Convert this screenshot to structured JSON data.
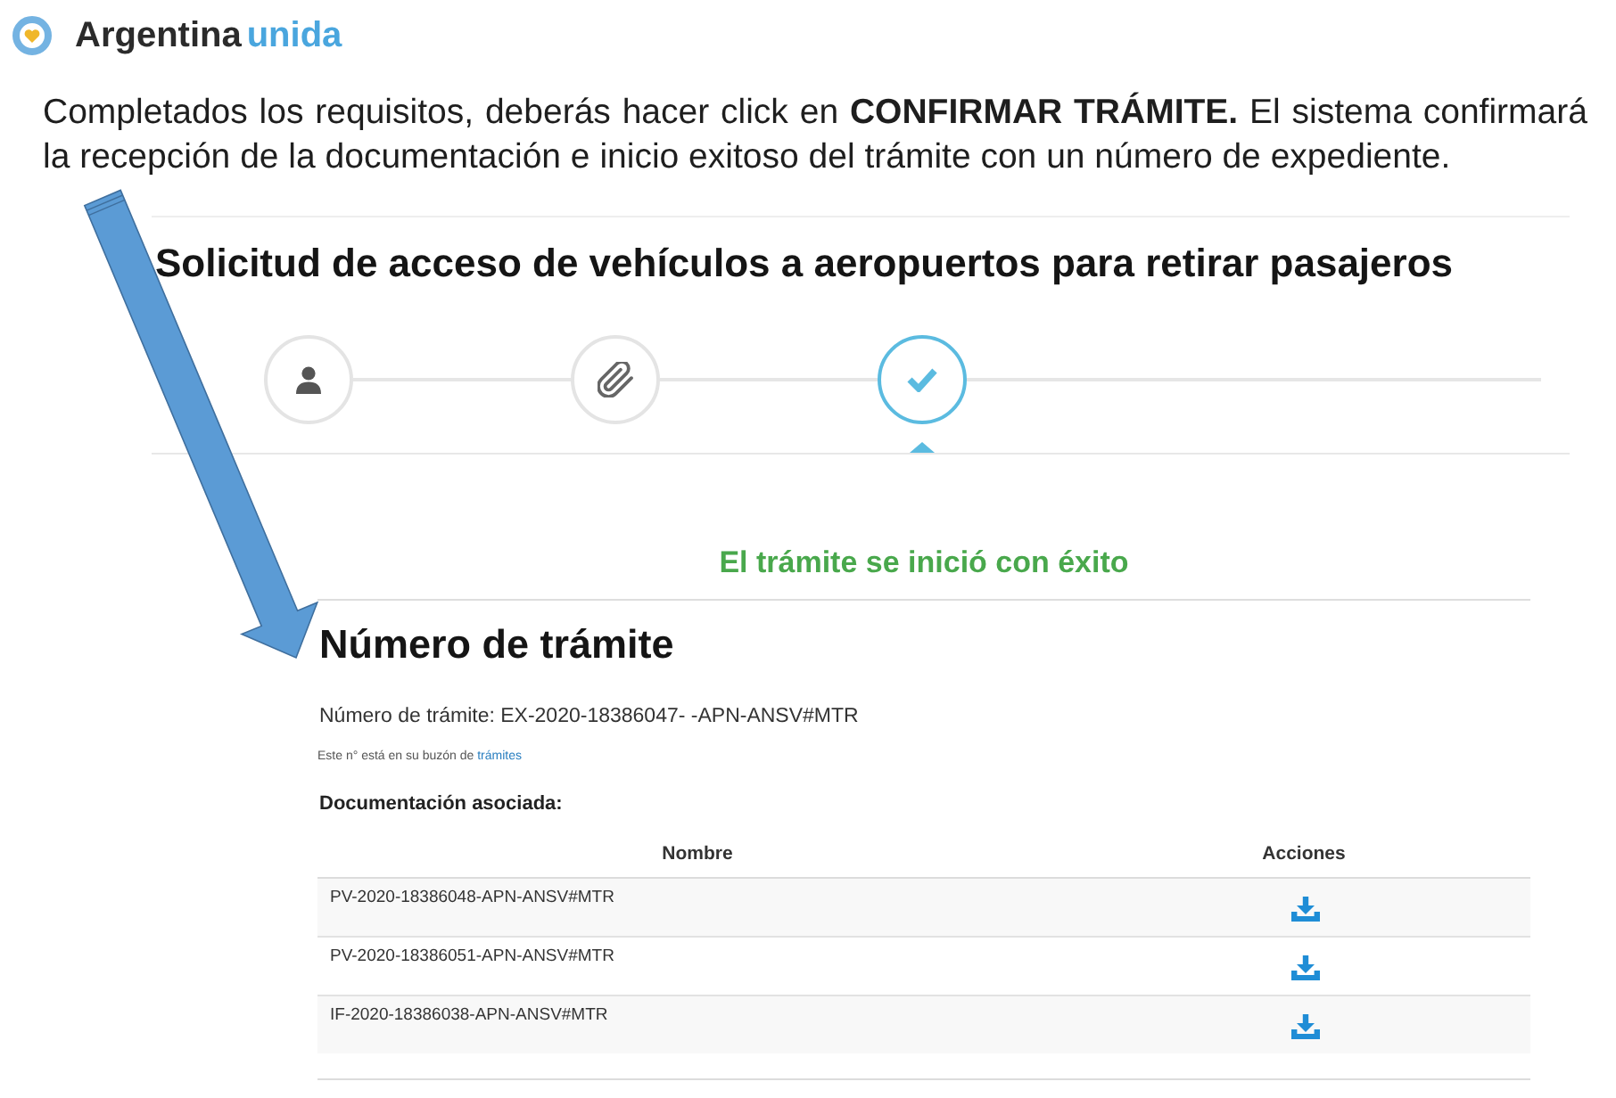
{
  "brand": {
    "name": "Argentina",
    "accent": "unida"
  },
  "instructions": "Completados los requisitos, deberás hacer click en **CONFIRMAR TRÁMITE.** El sistema confirmará la recepción de la documentación e inicio exitoso del trámite con un número de expediente.",
  "form": {
    "title": "Solicitud de acceso de vehículos a aeropuertos para retirar pasajeros",
    "steps": [
      {
        "kind": "person",
        "selected": false
      },
      {
        "kind": "attachment",
        "selected": false
      },
      {
        "kind": "confirm",
        "selected": true
      }
    ],
    "success_message": "El trámite se inició con éxito",
    "heading": "Número de trámite",
    "number_line": "Número de trámite: EX-2020-18386047- -APN-ANSV#MTR",
    "inbox_note": {
      "text": "Este n° está en su buzón de",
      "link": "trámites"
    },
    "documents": {
      "title": "Documentación asociada:",
      "columns": [
        "Nombre",
        "Acciones"
      ],
      "rows": [
        {
          "name": "PV-2020-18386048-APN-ANSV#MTR"
        },
        {
          "name": "PV-2020-18386051-APN-ANSV#MTR"
        },
        {
          "name": "IF-2020-18386038-APN-ANSV#MTR"
        }
      ]
    }
  }
}
